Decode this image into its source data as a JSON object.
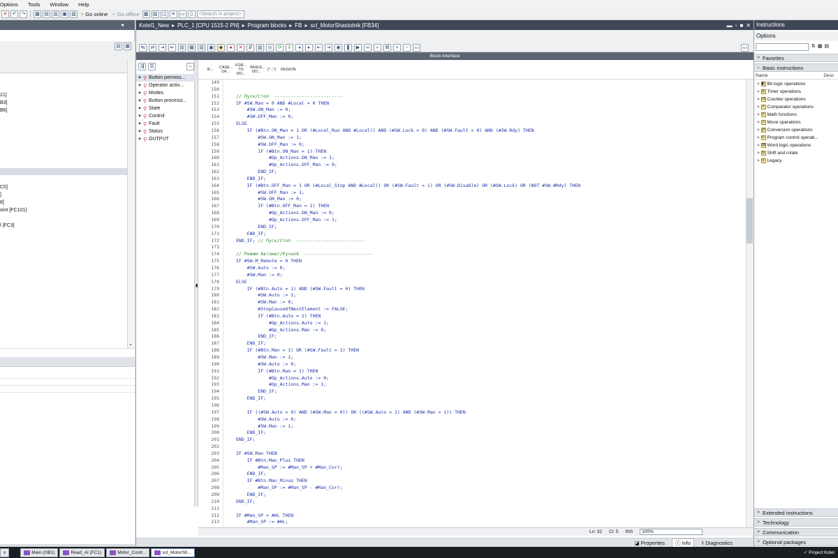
{
  "menu": [
    "Options",
    "Tools",
    "Window",
    "Help"
  ],
  "toolbar": {
    "go_online": "Go online",
    "go_offline": "Go offline",
    "search_placeholder": "<Search in project>"
  },
  "left_panel": {
    "tree_tail": [
      "21]",
      "B3]",
      "B6]",
      "C5]",
      "]",
      "8]",
      "oint [FC101]",
      "l [FC3]"
    ]
  },
  "editor": {
    "breadcrumb": [
      "Kotel1_New",
      "PLC_1 [CPU 1515-2 PN]",
      "Program blocks",
      "FB",
      "scl_MotorShastotnik [FB34]"
    ],
    "block_interface_label": "Block interface",
    "interface": [
      {
        "name": "Button permiss..."
      },
      {
        "name": "Operator actio..."
      },
      {
        "name": "Modes"
      },
      {
        "name": "Button processi..."
      },
      {
        "name": "State"
      },
      {
        "name": "Control"
      },
      {
        "name": "Fault"
      },
      {
        "name": "Status"
      },
      {
        "name": "OUTPUT"
      }
    ],
    "keywords": [
      "IF...",
      "CASE... OF...",
      "FOR... TO DO...",
      "WHILE... DO...",
      "(*...*)",
      "REGION"
    ],
    "first_line": 149,
    "code": [
      "",
      "",
      "// Пуск/Стоп  -------------------------",
      "IF #SW.Man = 0 AND #Local = 0 THEN",
      "    #SW.ON_Man := 0;",
      "    #SW.OFF_Man := 0;",
      "ELSE",
      "    IF (#Btn.ON_Man = 1 OR (#Local_Run AND #Local)) AND (#SW.Lock = 0) AND (#SW.Fault = 0) AND (#SW.Rdy) THEN",
      "        #SW.ON_Man := 1;",
      "        #SW.OFF_Man := 0;",
      "        IF (#Btn.ON_Man = 1) THEN",
      "            #Op_Actions.ON_Man := 1;",
      "            #Op_Actions.OFF_Man := 0;",
      "        END_IF;",
      "    END_IF;",
      "    IF (#Btn.OFF_Man = 1 OR (#Local_Stop AND #Local)) OR (#SW.Fault = 1) OR (#SW.Disable) OR (#SW.Lock) OR (NOT #SW.#Rdy) THEN",
      "        #SW.OFF_Man := 1;",
      "        #SW.ON_Man := 0;",
      "        IF (#Btn.OFF_Man = 1) THEN",
      "            #Op_Actions.ON_Man := 0;",
      "            #Op_Actions.OFF_Man := 1;",
      "        END_IF;",
      "    END_IF;",
      "END_IF; // Пуск/Стоп  -------------------------",
      "",
      "// Режим Автомат/Ручной  -------------------------",
      "IF #SW.M_Remote = 0 THEN",
      "    #SW.Auto := 0;",
      "    #SW.Man := 0;",
      "ELSE",
      "    IF (#Btn.Auto = 1) AND (#SW.Fault = 0) THEN",
      "        #SW.Auto := 1;",
      "        #SW.Man := 0;",
      "        #StopCauseOfNextElement := FALSE;",
      "        IF (#Btn.Auto = 1) THEN",
      "            #Op_Actions.Auto := 1;",
      "            #Op_Actions.Man := 0;",
      "        END_IF;",
      "    END_IF;",
      "    IF (#Btn.Man = 1) OR (#SW.Fault = 1) THEN",
      "        #SW.Man := 1;",
      "        #SW.Auto := 0;",
      "        IF (#Btn.Man = 1) THEN",
      "            #Op_Actions.Auto := 0;",
      "            #Op_Actions.Man := 1;",
      "        END_IF;",
      "    END_IF;",
      "",
      "    IF ((#SW.Auto = 0) AND (#SW.Man = 0)) OR ((#SW.Auto = 1) AND (#SW.Man = 1)) THEN",
      "        #SW.Auto := 0;",
      "        #SW.Man := 1;",
      "    END_IF;",
      "END_IF;",
      "",
      "IF #SW.Man THEN",
      "    IF #Btn.Man_Plus THEN",
      "        #Man_SP := #Man_SP + #Man_Corr;",
      "    END_IF;",
      "    IF #Btn.Man_Minus THEN",
      "        #Man_SP := #Man_SP - #Man_Corr;",
      "    END_IF;",
      "END_IF;",
      "",
      "IF #Man_SP > #HL THEN",
      "    #Man_SP := #HL;"
    ],
    "status": {
      "ln": "Ln: 32",
      "cl": "Cl: 5",
      "ins": "INS",
      "zoom": "100%"
    },
    "bottom_tabs": [
      "Properties",
      "Info",
      "Diagnostics"
    ]
  },
  "right_panel": {
    "title": "Instructions",
    "options_label": "Options",
    "sections_top": [
      "Favorites",
      "Basic instructions"
    ],
    "col_name": "Name",
    "col_desc": "Desc",
    "basic": [
      "Bit logic operations",
      "Timer operations",
      "Counter operations",
      "Comparator operations",
      "Math functions",
      "Move operations",
      "Conversion operations",
      "Program control operati...",
      "Word logic operations",
      "Shift and rotate",
      "Legacy"
    ],
    "sections_bottom": [
      "Extended instructions",
      "Technology",
      "Communication",
      "Optional packages"
    ]
  },
  "taskbar": {
    "first": "v",
    "tabs": [
      "Main (OB1)",
      "Read_AI (FC1)",
      "Motor_Contr...",
      "scl_MotorSh..."
    ],
    "right": "Project Kotel"
  }
}
